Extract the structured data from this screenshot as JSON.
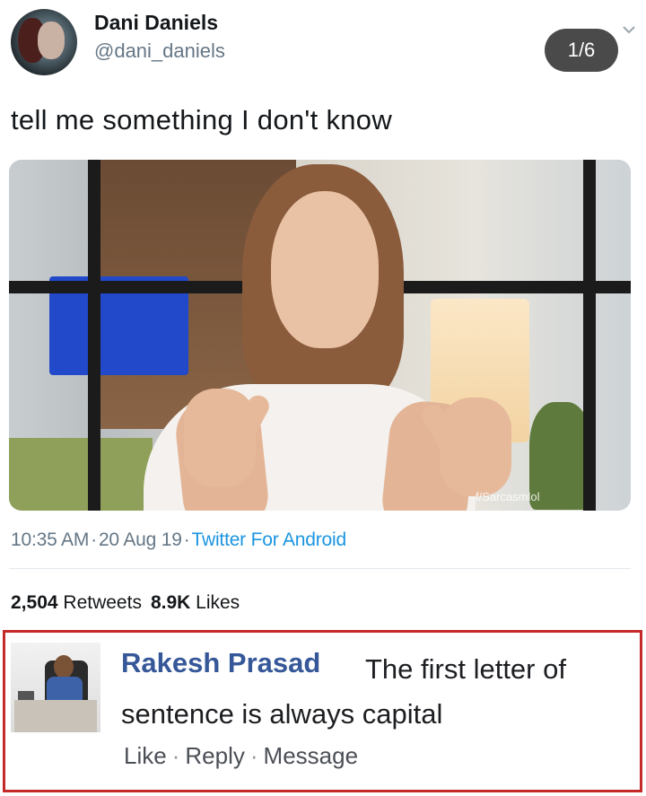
{
  "tweet": {
    "display_name": "Dani Daniels",
    "handle": "@dani_daniels",
    "page_indicator": "1/6",
    "text": "tell me something I don't know",
    "media_watermark": "f/Sarcasmlol",
    "time": "10:35 AM",
    "date": "20 Aug 19",
    "source": "Twitter For Android",
    "separator": "·",
    "retweets_count": "2,504",
    "retweets_label": "Retweets",
    "likes_count": "8.9K",
    "likes_label": "Likes"
  },
  "comment": {
    "author": "Rakesh Prasad",
    "text": "The first letter of sentence is always capital",
    "actions": {
      "like": "Like",
      "reply": "Reply",
      "message": "Message",
      "separator": "·"
    }
  },
  "icons": {
    "chevron": "chevron-down-icon"
  },
  "colors": {
    "link_blue": "#1b95e0",
    "name_blue": "#365899",
    "highlight_border": "#c42a2a",
    "badge_bg": "#4a4a4a"
  }
}
